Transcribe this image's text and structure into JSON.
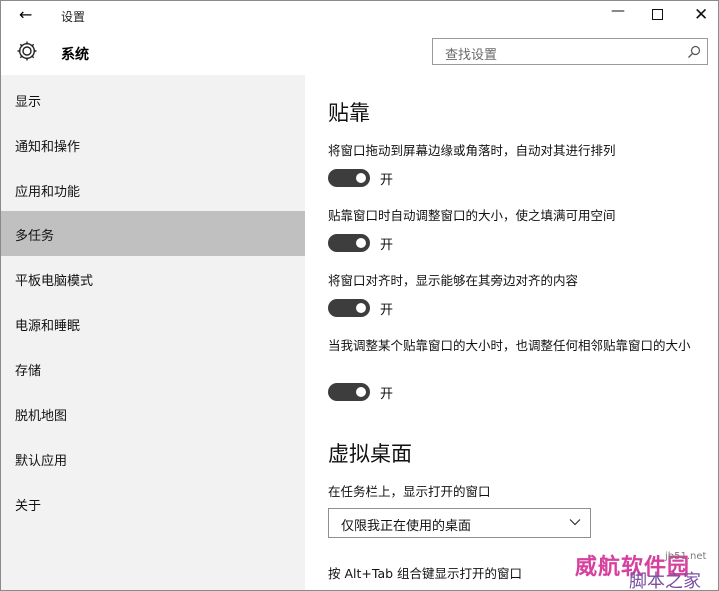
{
  "window": {
    "back_glyph": "←",
    "title": "设置",
    "minimize_glyph": "—",
    "close_glyph": "✕"
  },
  "header": {
    "icon": "gear-icon",
    "title": "系统",
    "search_placeholder": "查找设置",
    "search_icon": "search-icon"
  },
  "sidebar": {
    "items": [
      {
        "label": "显示"
      },
      {
        "label": "通知和操作"
      },
      {
        "label": "应用和功能"
      },
      {
        "label": "多任务",
        "selected": true
      },
      {
        "label": "平板电脑模式"
      },
      {
        "label": "电源和睡眠"
      },
      {
        "label": "存储"
      },
      {
        "label": "脱机地图"
      },
      {
        "label": "默认应用"
      },
      {
        "label": "关于"
      }
    ]
  },
  "main": {
    "snap": {
      "heading": "贴靠",
      "options": [
        {
          "text": "将窗口拖动到屏幕边缘或角落时，自动对其进行排列",
          "state_label": "开",
          "on": true
        },
        {
          "text": "贴靠窗口时自动调整窗口的大小，使之填满可用空间",
          "state_label": "开",
          "on": true
        },
        {
          "text": "将窗口对齐时，显示能够在其旁边对齐的内容",
          "state_label": "开",
          "on": true
        },
        {
          "text": "当我调整某个贴靠窗口的大小时，也调整任何相邻贴靠窗口的大小",
          "state_label": "开",
          "on": true
        }
      ]
    },
    "virtual_desktops": {
      "heading": "虚拟桌面",
      "taskbar_label": "在任务栏上，显示打开的窗口",
      "taskbar_value": "仅限我正在使用的桌面",
      "alt_tab_label": "按 Alt+Tab 组合键显示打开的窗口"
    }
  },
  "watermark": {
    "line1": "威航软件园",
    "line2": "脚本之家",
    "line3": "jb51.net"
  },
  "colors": {
    "sidebar_bg": "#f2f2f2",
    "selected_bg": "#c0c0c0",
    "toggle_on": "#3d3d3d"
  }
}
